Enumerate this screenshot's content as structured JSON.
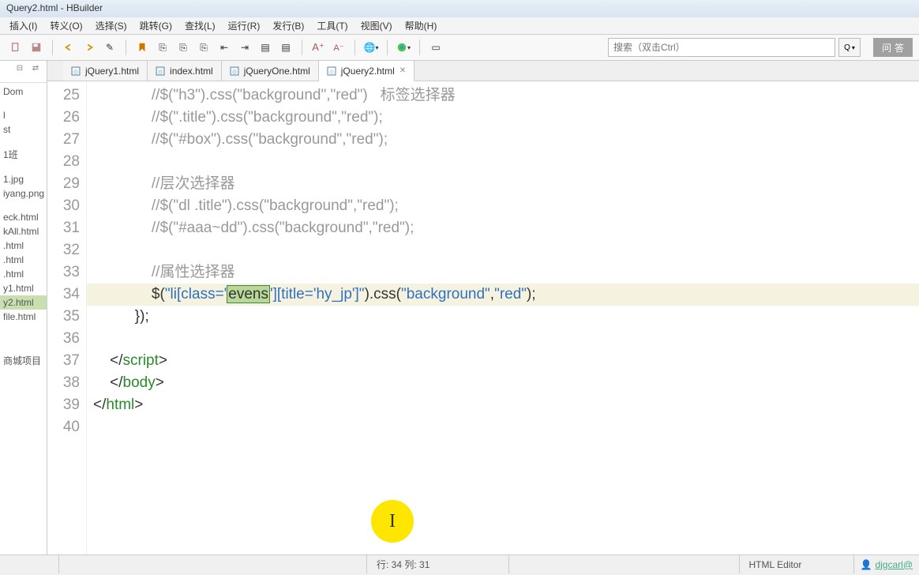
{
  "title": "Query2.html  -  HBuilder",
  "menus": [
    "插入(I)",
    "转义(O)",
    "选择(S)",
    "跳转(G)",
    "查找(L)",
    "运行(R)",
    "发行(B)",
    "工具(T)",
    "视图(V)",
    "帮助(H)"
  ],
  "search_placeholder": "搜索（双击Ctrl）",
  "qa_label": "问答",
  "tabs": [
    {
      "label": "jQuery1.html",
      "active": false
    },
    {
      "label": "index.html",
      "active": false
    },
    {
      "label": "jQueryOne.html",
      "active": false
    },
    {
      "label": "jQuery2.html",
      "active": true
    }
  ],
  "sidebar_files": [
    {
      "label": "Dom",
      "type": "item"
    },
    {
      "label": "",
      "type": "spacer"
    },
    {
      "label": "l",
      "type": "item"
    },
    {
      "label": "st",
      "type": "item"
    },
    {
      "label": "",
      "type": "spacer"
    },
    {
      "label": "1班",
      "type": "item"
    },
    {
      "label": "",
      "type": "spacer"
    },
    {
      "label": "1.jpg",
      "type": "item"
    },
    {
      "label": "iyang.png",
      "type": "item"
    },
    {
      "label": "",
      "type": "spacer"
    },
    {
      "label": "eck.html",
      "type": "item"
    },
    {
      "label": "kAll.html",
      "type": "item"
    },
    {
      "label": ".html",
      "type": "item"
    },
    {
      "label": ".html",
      "type": "item"
    },
    {
      "label": ".html",
      "type": "item"
    },
    {
      "label": "y1.html",
      "type": "item"
    },
    {
      "label": "y2.html",
      "type": "item",
      "sel": true
    },
    {
      "label": "file.html",
      "type": "item"
    },
    {
      "label": "",
      "type": "spacer"
    },
    {
      "label": "",
      "type": "spacer"
    },
    {
      "label": "",
      "type": "spacer"
    },
    {
      "label": "商城项目",
      "type": "item"
    }
  ],
  "line_start": 25,
  "line_end": 40,
  "code_lines": [
    {
      "n": 25,
      "type": "comment",
      "indent": "              ",
      "text": "//$(\"h3\").css(\"background\",\"red\")   标签选择器"
    },
    {
      "n": 26,
      "type": "comment",
      "indent": "              ",
      "text": "//$(\".title\").css(\"background\",\"red\");"
    },
    {
      "n": 27,
      "type": "comment",
      "indent": "              ",
      "text": "//$(\"#box\").css(\"background\",\"red\");"
    },
    {
      "n": 28,
      "type": "blank"
    },
    {
      "n": 29,
      "type": "comment",
      "indent": "              ",
      "text": "//层次选择器"
    },
    {
      "n": 30,
      "type": "comment",
      "indent": "              ",
      "text": "//$(\"dl .title\").css(\"background\",\"red\");"
    },
    {
      "n": 31,
      "type": "comment",
      "indent": "              ",
      "text": "//$(\"#aaa~dd\").css(\"background\",\"red\");"
    },
    {
      "n": 32,
      "type": "blank"
    },
    {
      "n": 33,
      "type": "comment",
      "indent": "              ",
      "text": "//属性选择器"
    },
    {
      "n": 34,
      "type": "code",
      "hl": true
    },
    {
      "n": 35,
      "type": "close",
      "indent": "          ",
      "text": "});"
    },
    {
      "n": 36,
      "type": "blank"
    },
    {
      "n": 37,
      "type": "tag",
      "indent": "    ",
      "tag": "script",
      "close": true
    },
    {
      "n": 38,
      "type": "tag",
      "indent": "    ",
      "tag": "body",
      "close": true
    },
    {
      "n": 39,
      "type": "tag",
      "indent": "",
      "tag": "html",
      "close": true
    },
    {
      "n": 40,
      "type": "blank"
    }
  ],
  "line34": {
    "indent": "              ",
    "pre": "$(",
    "str1": "\"li[class='",
    "sel": "evens",
    "str2": "'][title='hy_jp']\"",
    "mid": ").css(",
    "str3": "\"background\"",
    "comma": ",",
    "str4": "\"red\"",
    "post": ");"
  },
  "status": {
    "cursor": "行: 34 列: 31",
    "editor": "HTML Editor",
    "user": "djgcarl@"
  }
}
